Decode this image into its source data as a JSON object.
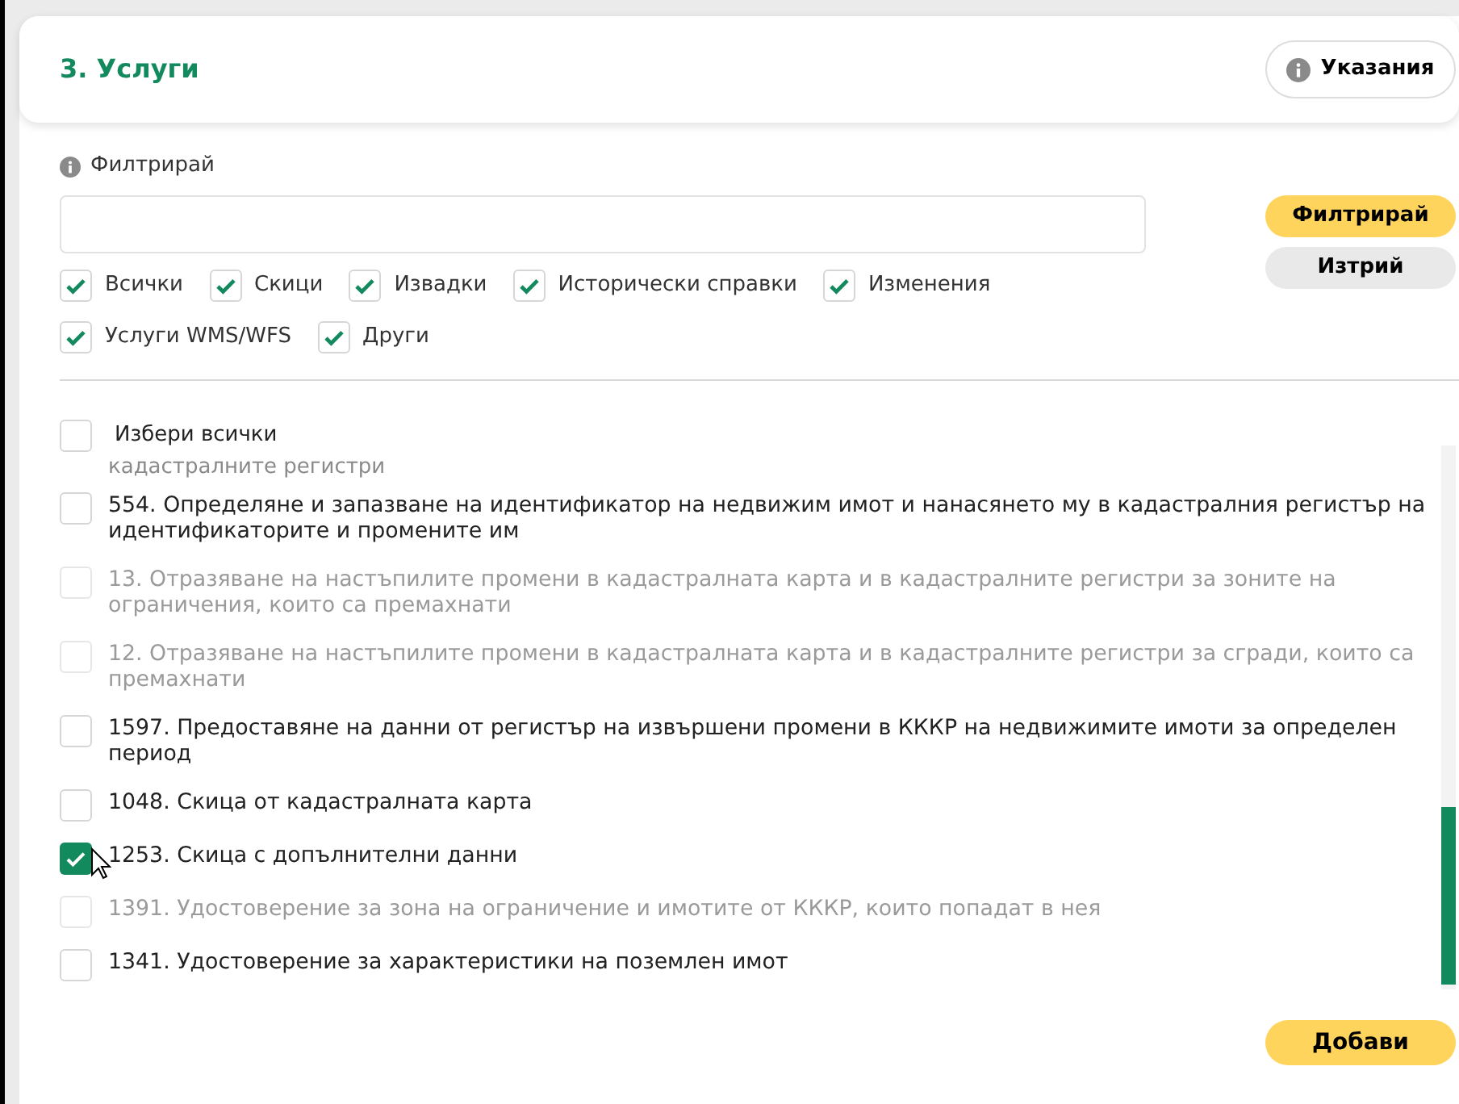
{
  "section": {
    "title": "3. Услуги",
    "help_button": "Указания"
  },
  "filter": {
    "label": "Филтрирай",
    "apply_button": "Филтрирай",
    "clear_button": "Изтрий"
  },
  "categories": [
    {
      "label": "Всички",
      "checked": true
    },
    {
      "label": "Скици",
      "checked": true
    },
    {
      "label": "Извадки",
      "checked": true
    },
    {
      "label": "Исторически справки",
      "checked": true
    },
    {
      "label": "Изменения",
      "checked": true
    },
    {
      "label": "Услуги WMS/WFS",
      "checked": true
    },
    {
      "label": "Други",
      "checked": true
    }
  ],
  "select_all": {
    "label": "Избери всички",
    "checked": false
  },
  "clipped_text": "кадастралните регистри",
  "services": [
    {
      "label": "554. Определяне и запазване на идентификатор на недвижим имот и нанасянето му в кадастралния регистър на идентификаторите и промените им",
      "checked": false,
      "disabled": false
    },
    {
      "label": "13. Отразяване на настъпилите промени в кадастралната карта и в кадастралните регистри за зоните на ограничения, които са премахнати",
      "checked": false,
      "disabled": true
    },
    {
      "label": "12. Отразяване на настъпилите промени в кадастралната карта и в кадастралните регистри за сгради, които са премахнати",
      "checked": false,
      "disabled": true
    },
    {
      "label": "1597. Предоставяне на данни от регистър на извършени промени в КККР на недвижимите имоти за определен период",
      "checked": false,
      "disabled": false
    },
    {
      "label": "1048. Скица от кадастралната карта",
      "checked": false,
      "disabled": false
    },
    {
      "label": "1253. Скица с допълнителни данни",
      "checked": true,
      "disabled": false
    },
    {
      "label": "1391. Удостоверение за зона на ограничение и имотите от КККР, които попадат в нея",
      "checked": false,
      "disabled": true
    },
    {
      "label": "1341. Удостоверение за характеристики на поземлен имот",
      "checked": false,
      "disabled": false
    }
  ],
  "add_button": "Добави"
}
